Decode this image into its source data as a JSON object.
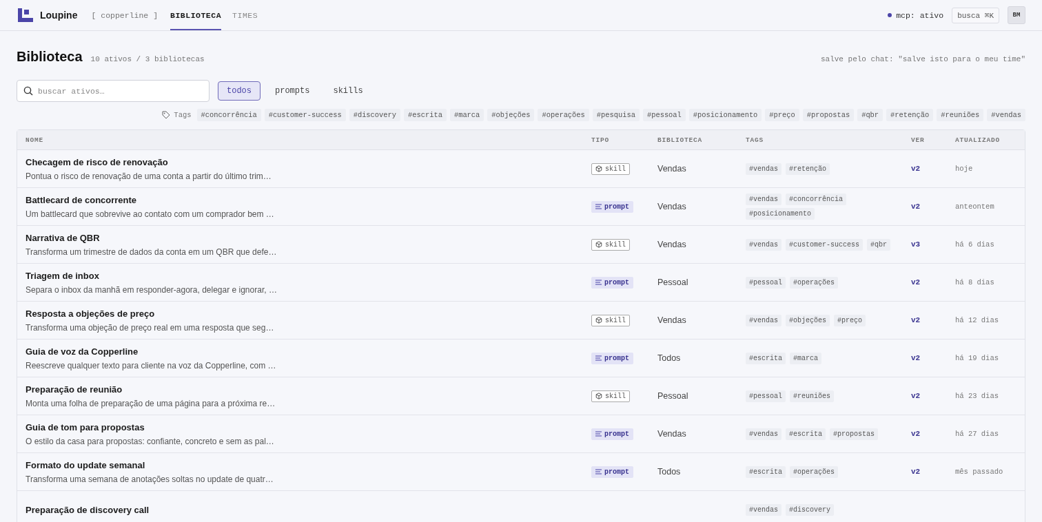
{
  "app": {
    "name": "Loupine",
    "workspace": "[ copperline ]"
  },
  "nav_tabs": [
    {
      "label": "BIBLIOTECA",
      "selected": true
    },
    {
      "label": "TIMES",
      "selected": false
    }
  ],
  "status": {
    "label": "mcp: ativo"
  },
  "search_button": {
    "label": "busca ⌘K"
  },
  "avatar": {
    "initials": "BM"
  },
  "page": {
    "title": "Biblioteca",
    "subtitle": "10 ativos / 3 bibliotecas",
    "hint": "salve pelo chat: \"salve isto para o meu time\""
  },
  "search": {
    "placeholder": "buscar ativos…"
  },
  "filters": [
    {
      "label": "todos",
      "selected": true
    },
    {
      "label": "prompts",
      "selected": false
    },
    {
      "label": "skills",
      "selected": false
    }
  ],
  "tag_filter": {
    "label": "Tags",
    "tags": [
      "#concorrência",
      "#customer-success",
      "#discovery",
      "#escrita",
      "#marca",
      "#objeções",
      "#operações",
      "#pesquisa",
      "#pessoal",
      "#posicionamento",
      "#preço",
      "#propostas",
      "#qbr",
      "#retenção",
      "#reuniões",
      "#vendas"
    ]
  },
  "table": {
    "columns": [
      "NOME",
      "TIPO",
      "BIBLIOTECA",
      "TAGS",
      "VER",
      "ATUALIZADO"
    ],
    "rows": [
      {
        "name": "Checagem de risco de renovação",
        "description": "Pontua o risco de renovação de uma conta a partir do último trim…",
        "kind": "skill",
        "type": "skill",
        "library": "Vendas",
        "tags": [
          "#vendas",
          "#retenção"
        ],
        "version": "v2",
        "updated": "hoje"
      },
      {
        "name": "Battlecard de concorrente",
        "description": "Um battlecard que sobrevive ao contato com um comprador bem …",
        "kind": "prompt",
        "type": "prompt",
        "library": "Vendas",
        "tags": [
          "#vendas",
          "#concorrência",
          "#posicionamento"
        ],
        "version": "v2",
        "updated": "anteontem"
      },
      {
        "name": "Narrativa de QBR",
        "description": "Transforma um trimestre de dados da conta em um QBR que defe…",
        "kind": "skill",
        "type": "skill",
        "library": "Vendas",
        "tags": [
          "#vendas",
          "#customer-success",
          "#qbr"
        ],
        "version": "v3",
        "updated": "há 6 dias"
      },
      {
        "name": "Triagem de inbox",
        "description": "Separa o inbox da manhã em responder-agora, delegar e ignorar, …",
        "kind": "prompt",
        "type": "prompt",
        "library": "Pessoal",
        "tags": [
          "#pessoal",
          "#operações"
        ],
        "version": "v2",
        "updated": "há 8 dias"
      },
      {
        "name": "Resposta a objeções de preço",
        "description": "Transforma uma objeção de preço real em uma resposta que seg…",
        "kind": "skill",
        "type": "skill",
        "library": "Vendas",
        "tags": [
          "#vendas",
          "#objeções",
          "#preço"
        ],
        "version": "v2",
        "updated": "há 12 dias"
      },
      {
        "name": "Guia de voz da Copperline",
        "description": "Reescreve qualquer texto para cliente na voz da Copperline, com …",
        "kind": "prompt",
        "type": "prompt",
        "library": "Todos",
        "tags": [
          "#escrita",
          "#marca"
        ],
        "version": "v2",
        "updated": "há 19 dias"
      },
      {
        "name": "Preparação de reunião",
        "description": "Monta uma folha de preparação de uma página para a próxima re…",
        "kind": "skill",
        "type": "skill",
        "library": "Pessoal",
        "tags": [
          "#pessoal",
          "#reuniões"
        ],
        "version": "v2",
        "updated": "há 23 dias"
      },
      {
        "name": "Guia de tom para propostas",
        "description": "O estilo da casa para propostas: confiante, concreto e sem as pal…",
        "kind": "prompt",
        "type": "prompt",
        "library": "Vendas",
        "tags": [
          "#vendas",
          "#escrita",
          "#propostas"
        ],
        "version": "v2",
        "updated": "há 27 dias"
      },
      {
        "name": "Formato do update semanal",
        "description": "Transforma uma semana de anotações soltas no update de quatr…",
        "kind": "prompt",
        "type": "prompt",
        "library": "Todos",
        "tags": [
          "#escrita",
          "#operações"
        ],
        "version": "v2",
        "updated": "mês passado"
      },
      {
        "name": "Preparação de discovery call",
        "tags": [
          "#vendas",
          "#discovery"
        ]
      }
    ]
  }
}
